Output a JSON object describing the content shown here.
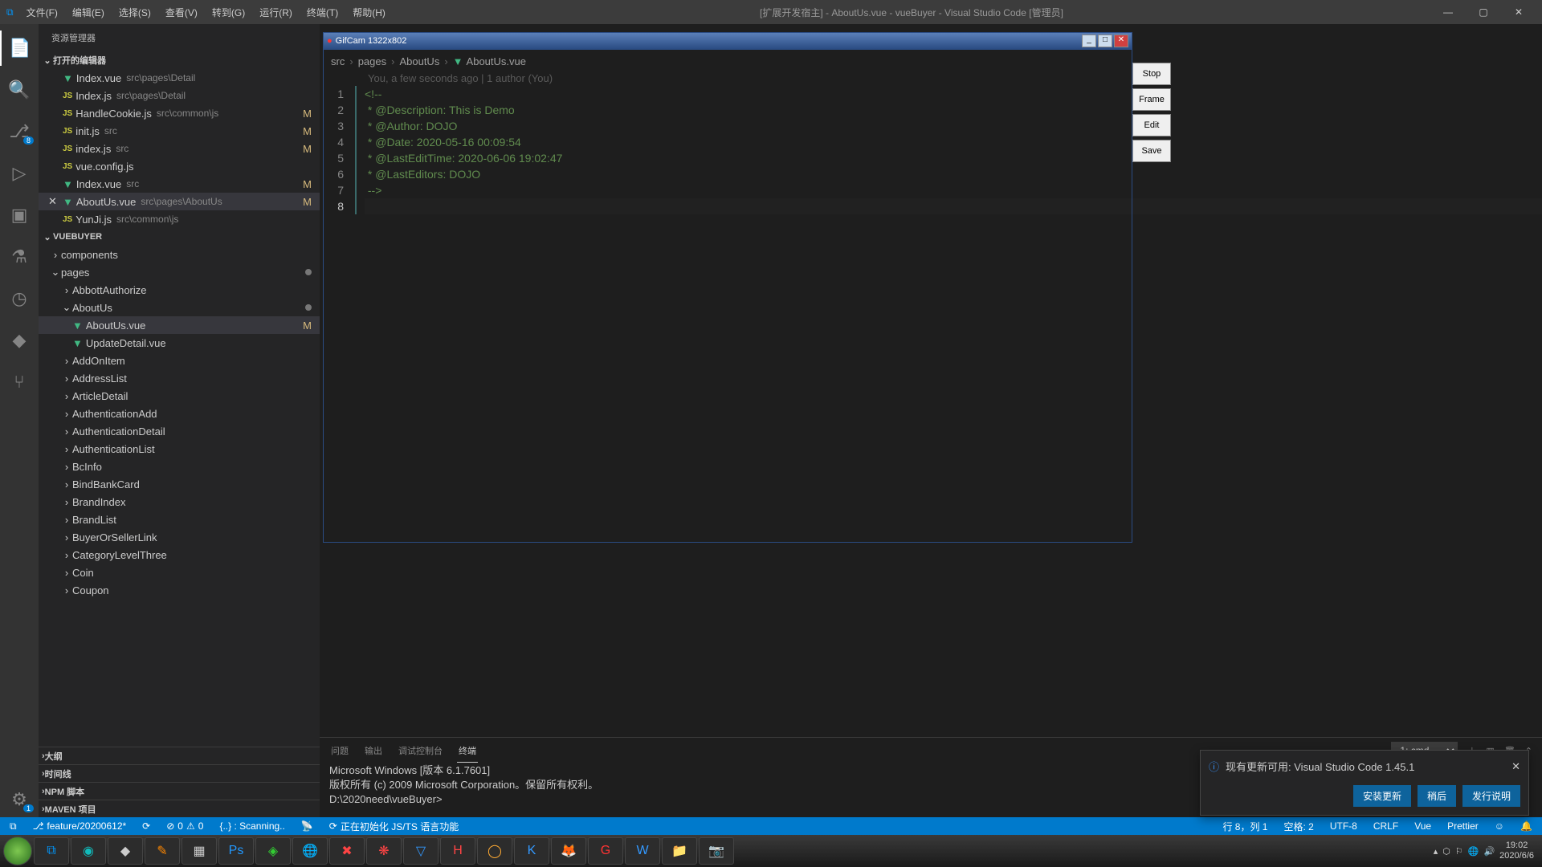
{
  "menubar": [
    "文件(F)",
    "编辑(E)",
    "选择(S)",
    "查看(V)",
    "转到(G)",
    "运行(R)",
    "终端(T)",
    "帮助(H)"
  ],
  "window_title": "[扩展开发宿主] - AboutUs.vue - vueBuyer - Visual Studio Code [管理员]",
  "sidebar_title": "资源管理器",
  "open_editors_label": "打开的编辑器",
  "open_editors": [
    {
      "icon": "vue",
      "name": "Index.vue",
      "path": "src\\pages\\Detail",
      "mod": ""
    },
    {
      "icon": "js",
      "name": "Index.js",
      "path": "src\\pages\\Detail",
      "mod": ""
    },
    {
      "icon": "js",
      "name": "HandleCookie.js",
      "path": "src\\common\\js",
      "mod": "M"
    },
    {
      "icon": "js",
      "name": "init.js",
      "path": "src",
      "mod": "M"
    },
    {
      "icon": "js",
      "name": "index.js",
      "path": "src",
      "mod": "M"
    },
    {
      "icon": "js",
      "name": "vue.config.js",
      "path": "",
      "mod": ""
    },
    {
      "icon": "vue",
      "name": "Index.vue",
      "path": "src",
      "mod": "M"
    },
    {
      "icon": "vue",
      "name": "AboutUs.vue",
      "path": "src\\pages\\AboutUs",
      "mod": "M",
      "active": true
    },
    {
      "icon": "js",
      "name": "YunJi.js",
      "path": "src\\common\\js",
      "mod": ""
    }
  ],
  "project_label": "VUEBUYER",
  "tree": [
    {
      "indent": 1,
      "chev": ">",
      "label": "components"
    },
    {
      "indent": 1,
      "chev": "v",
      "label": "pages",
      "dot": true
    },
    {
      "indent": 2,
      "chev": ">",
      "label": "AbbottAuthorize"
    },
    {
      "indent": 2,
      "chev": "v",
      "label": "AboutUs",
      "dot": true
    },
    {
      "indent": 3,
      "icon": "vue",
      "label": "AboutUs.vue",
      "mod": "M",
      "active": true
    },
    {
      "indent": 3,
      "icon": "vue",
      "label": "UpdateDetail.vue"
    },
    {
      "indent": 2,
      "chev": ">",
      "label": "AddOnItem"
    },
    {
      "indent": 2,
      "chev": ">",
      "label": "AddressList"
    },
    {
      "indent": 2,
      "chev": ">",
      "label": "ArticleDetail"
    },
    {
      "indent": 2,
      "chev": ">",
      "label": "AuthenticationAdd"
    },
    {
      "indent": 2,
      "chev": ">",
      "label": "AuthenticationDetail"
    },
    {
      "indent": 2,
      "chev": ">",
      "label": "AuthenticationList"
    },
    {
      "indent": 2,
      "chev": ">",
      "label": "BcInfo"
    },
    {
      "indent": 2,
      "chev": ">",
      "label": "BindBankCard"
    },
    {
      "indent": 2,
      "chev": ">",
      "label": "BrandIndex"
    },
    {
      "indent": 2,
      "chev": ">",
      "label": "BrandList"
    },
    {
      "indent": 2,
      "chev": ">",
      "label": "BuyerOrSellerLink"
    },
    {
      "indent": 2,
      "chev": ">",
      "label": "CategoryLevelThree"
    },
    {
      "indent": 2,
      "chev": ">",
      "label": "Coin"
    },
    {
      "indent": 2,
      "chev": ">",
      "label": "Coupon"
    }
  ],
  "collapsed_sections": [
    "大纲",
    "时间线",
    "NPM 脚本",
    "MAVEN 项目"
  ],
  "gifcam_title": "GifCam 1322x802",
  "gifcam_buttons": [
    "Stop",
    "Frame",
    "Edit",
    "Save"
  ],
  "breadcrumb": [
    "src",
    "pages",
    "AboutUs",
    "AboutUs.vue"
  ],
  "blame": "You, a few seconds ago | 1 author (You)",
  "code_lines": [
    "<!--",
    " * @Description: This is Demo",
    " * @Author: DOJO",
    " * @Date: 2020-05-16 00:09:54",
    " * @LastEditTime: 2020-06-06 19:02:47",
    " * @LastEditors: DOJO",
    " -->",
    ""
  ],
  "panel_tabs": [
    "问题",
    "输出",
    "调试控制台",
    "终端"
  ],
  "panel_active": "终端",
  "terminal_select": "1: cmd",
  "terminal_lines": [
    "Microsoft Windows [版本 6.1.7601]",
    "版权所有 (c) 2009 Microsoft Corporation。保留所有权利。",
    "",
    "D:\\2020need\\vueBuyer>"
  ],
  "toast_text": "现有更新可用: Visual Studio Code 1.45.1",
  "toast_actions": [
    "安装更新",
    "稍后",
    "发行说明"
  ],
  "status_left": {
    "branch": "feature/20200612*",
    "errors": "0",
    "warnings": "0",
    "scanning": "{..} : Scanning..",
    "init": "正在初始化 JS/TS 语言功能"
  },
  "status_right": [
    "行 8，列 1",
    "空格: 2",
    "UTF-8",
    "CRLF",
    "Vue",
    "Prettier"
  ],
  "clock": {
    "time": "19:02",
    "date": "2020/6/6"
  },
  "activity_badge": "8"
}
